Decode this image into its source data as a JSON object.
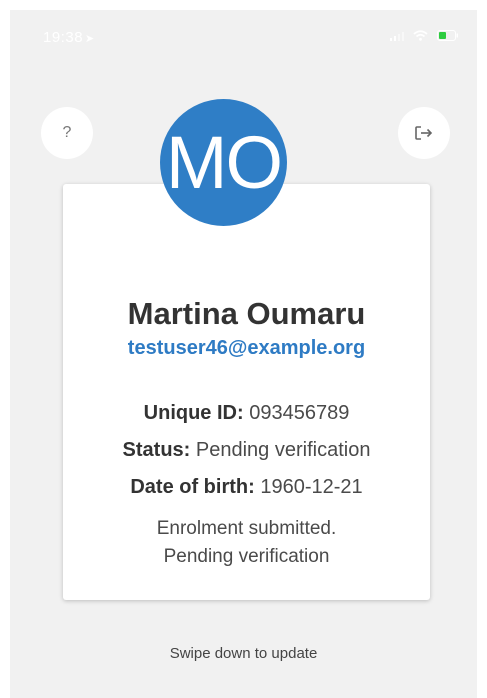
{
  "status_bar": {
    "time": "19:38",
    "location_icon": "location-arrow-icon",
    "icons": [
      "signal-icon",
      "wifi-icon",
      "battery-icon"
    ]
  },
  "header": {
    "help_label": "?",
    "logout_icon": "logout-icon"
  },
  "profile": {
    "initials": "MO",
    "name": "Martina Oumaru",
    "email": "testuser46@example.org",
    "fields": [
      {
        "label": "Unique ID:",
        "value": "093456789"
      },
      {
        "label": "Status:",
        "value": "Pending verification"
      },
      {
        "label": "Date of birth:",
        "value": "1960-12-21"
      }
    ],
    "message_line1": "Enrolment submitted.",
    "message_line2": "Pending verification"
  },
  "footer": {
    "swipe_hint": "Swipe down to update"
  },
  "colors": {
    "accent": "#2f7ec6",
    "email": "#2e7bc4",
    "background": "#f1f1f1",
    "card": "#ffffff",
    "battery": "#2ecc40"
  }
}
